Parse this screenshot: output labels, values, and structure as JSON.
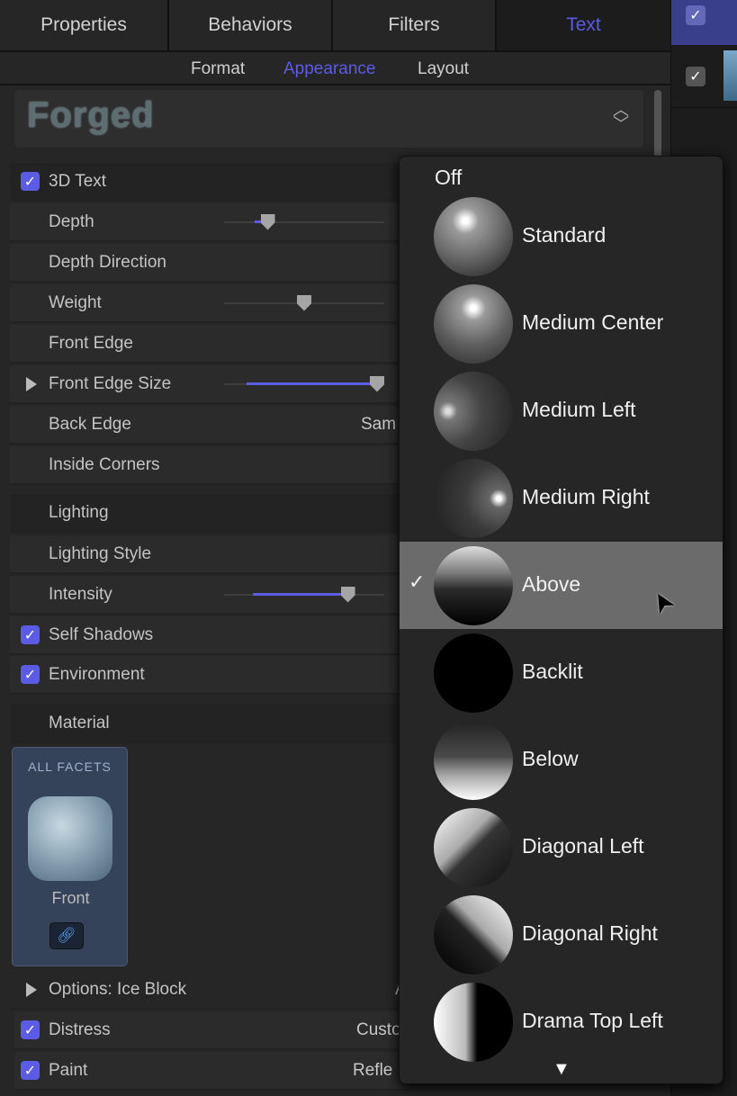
{
  "tabs": [
    "Properties",
    "Behaviors",
    "Filters",
    "Text"
  ],
  "subtabs": [
    "Format",
    "Appearance",
    "Layout"
  ],
  "preset": {
    "name": "Forged"
  },
  "rows": {
    "text3d": "3D Text",
    "depth": "Depth",
    "depth_direction": "Depth Direction",
    "weight": "Weight",
    "front_edge": "Front Edge",
    "front_edge_size": "Front Edge Size",
    "back_edge": "Back Edge",
    "back_edge_value": "Sam",
    "inside_corners": "Inside Corners",
    "lighting": "Lighting",
    "lighting_style": "Lighting Style",
    "intensity": "Intensity",
    "self_shadows": "Self Shadows",
    "environment": "Environment",
    "material": "Material",
    "options": "Options: Ice Block",
    "options_value": "A",
    "distress": "Distress",
    "distress_value": "Custo",
    "paint": "Paint",
    "paint_value": "Refle"
  },
  "sliders": {
    "depth": 0.25,
    "weight": 0.5,
    "front_edge_size": 1.0,
    "intensity": 0.8
  },
  "facet": {
    "header": "ALL FACETS",
    "label": "Front",
    "link_icon": "link-icon"
  },
  "popup": {
    "off": "Off",
    "items": [
      "Standard",
      "Medium Center",
      "Medium Left",
      "Medium Right",
      "Above",
      "Backlit",
      "Below",
      "Diagonal Left",
      "Diagonal Right",
      "Drama Top Left"
    ],
    "selected": "Above",
    "check": "✓",
    "more": "▼"
  },
  "colors": {
    "accent": "#5b5be6",
    "selected_bg": "#6b6b6b"
  }
}
